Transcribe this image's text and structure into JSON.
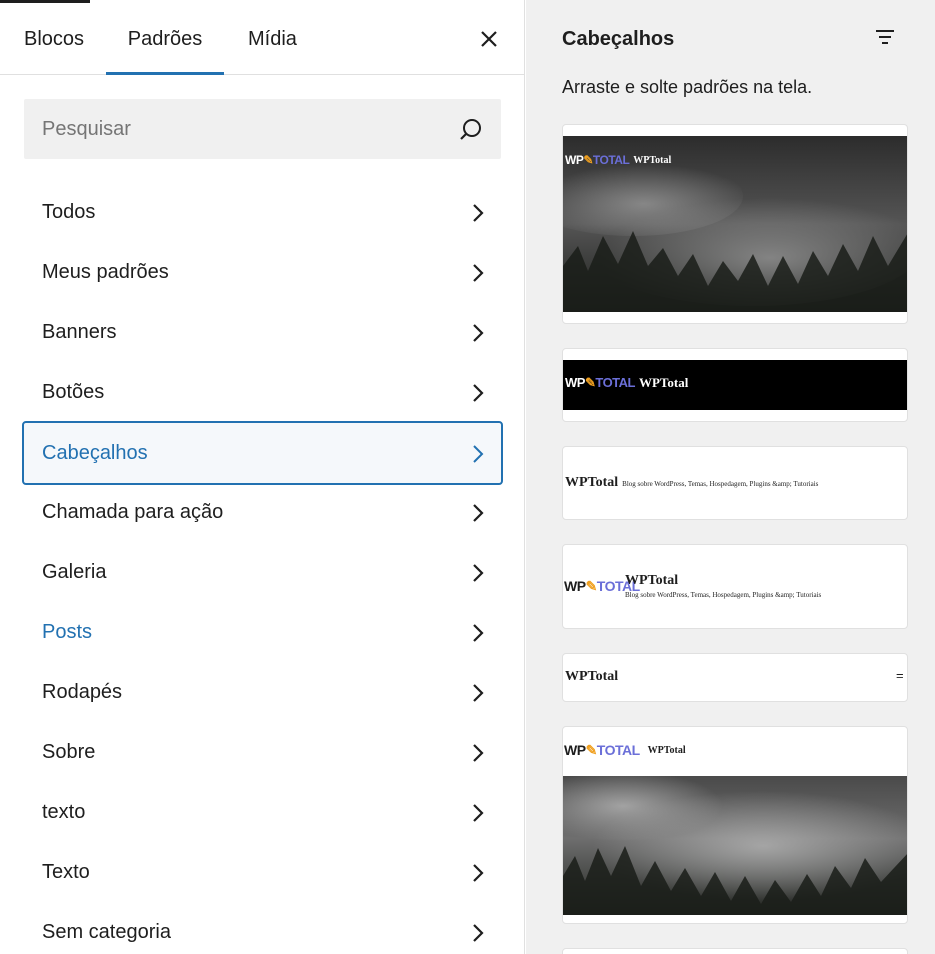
{
  "tabs": [
    {
      "label": "Blocos"
    },
    {
      "label": "Padrões"
    },
    {
      "label": "Mídia"
    }
  ],
  "search": {
    "placeholder": "Pesquisar",
    "value": ""
  },
  "categories": [
    {
      "label": "Todos"
    },
    {
      "label": "Meus padrões"
    },
    {
      "label": "Banners"
    },
    {
      "label": "Botões"
    },
    {
      "label": "Cabeçalhos"
    },
    {
      "label": "Chamada para ação"
    },
    {
      "label": "Galeria"
    },
    {
      "label": "Posts"
    },
    {
      "label": "Rodapés"
    },
    {
      "label": "Sobre"
    },
    {
      "label": "texto"
    },
    {
      "label": "Texto"
    },
    {
      "label": "Sem categoria"
    }
  ],
  "panel": {
    "title": "Cabeçalhos",
    "description": "Arraste e solte padrões na tela."
  },
  "previews": {
    "site_title": "WPTotal",
    "logo_wp": "WP",
    "logo_total": "TOTAL",
    "tagline": "Blog sobre WordPress, Temas, Hospedagem, Plugins &amp; Tutoriais",
    "menu_symbol": "="
  },
  "colors": {
    "accent": "#2271b1",
    "logo_purple": "#5b5fc7",
    "panel_bg": "#f0f0f0"
  },
  "icons": {
    "close": "close-icon",
    "search": "search-icon",
    "chevron": "chevron-right-icon",
    "filter": "filter-icon"
  }
}
